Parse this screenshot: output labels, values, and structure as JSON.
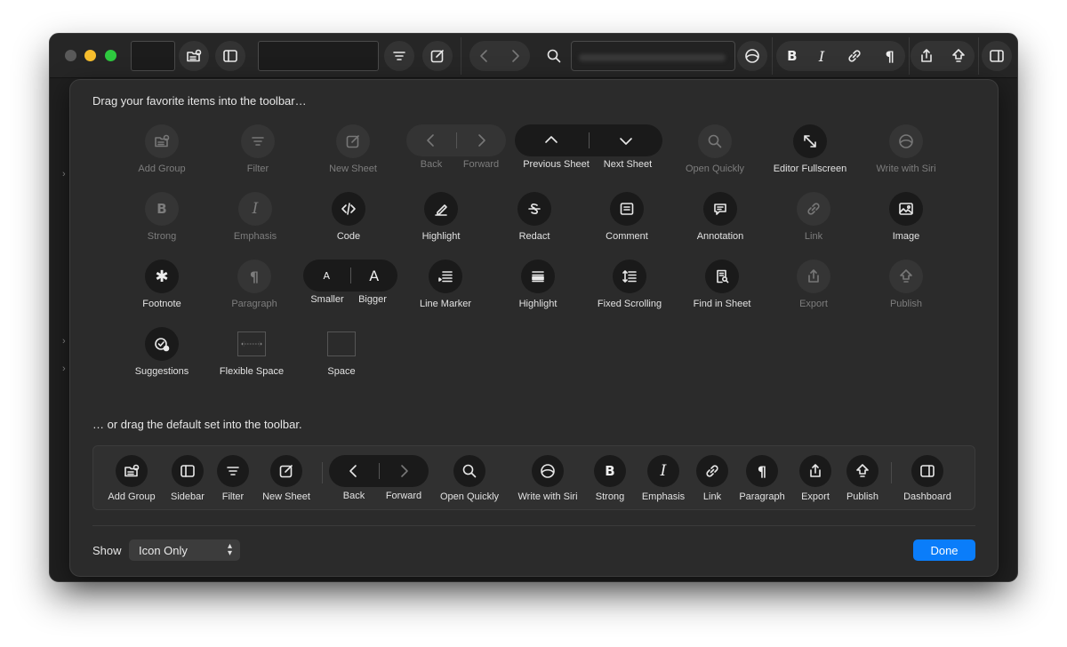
{
  "sheet": {
    "title": "Drag your favorite items into the toolbar…",
    "subtitle": "… or drag the default set into the toolbar.",
    "show_label": "Show",
    "show_value": "Icon Only",
    "done_label": "Done"
  },
  "items": {
    "add_group": "Add Group",
    "filter": "Filter",
    "new_sheet": "New Sheet",
    "back": "Back",
    "forward": "Forward",
    "previous_sheet": "Previous Sheet",
    "next_sheet": "Next Sheet",
    "open_quickly": "Open Quickly",
    "editor_fullscreen": "Editor Fullscreen",
    "write_with_siri": "Write with Siri",
    "strong": "Strong",
    "emphasis": "Emphasis",
    "code": "Code",
    "highlight": "Highlight",
    "redact": "Redact",
    "comment": "Comment",
    "annotation": "Annotation",
    "link": "Link",
    "image": "Image",
    "footnote": "Footnote",
    "paragraph": "Paragraph",
    "smaller": "Smaller",
    "bigger": "Bigger",
    "line_marker": "Line Marker",
    "highlight2": "Highlight",
    "fixed_scrolling": "Fixed Scrolling",
    "find_in_sheet": "Find in Sheet",
    "export": "Export",
    "publish": "Publish",
    "suggestions": "Suggestions",
    "flexible_space": "Flexible Space",
    "space": "Space"
  },
  "defaults": {
    "add_group": "Add Group",
    "sidebar": "Sidebar",
    "filter": "Filter",
    "new_sheet": "New Sheet",
    "back": "Back",
    "forward": "Forward",
    "open_quickly": "Open Quickly",
    "write_with_siri": "Write with Siri",
    "strong": "Strong",
    "emphasis": "Emphasis",
    "link": "Link",
    "paragraph": "Paragraph",
    "export": "Export",
    "publish": "Publish",
    "dashboard": "Dashboard"
  },
  "glyphs": {
    "strong": "B",
    "emphasis": "I",
    "paragraph": "¶",
    "footnote": "✱",
    "smaller": "A",
    "bigger": "A"
  },
  "colors": {
    "accent": "#0a7dfa",
    "window_bg": "#1f1f1f",
    "sheet_bg": "#2b2b2b",
    "traffic_min": "#f6bd2d",
    "traffic_max": "#2ec93f"
  }
}
